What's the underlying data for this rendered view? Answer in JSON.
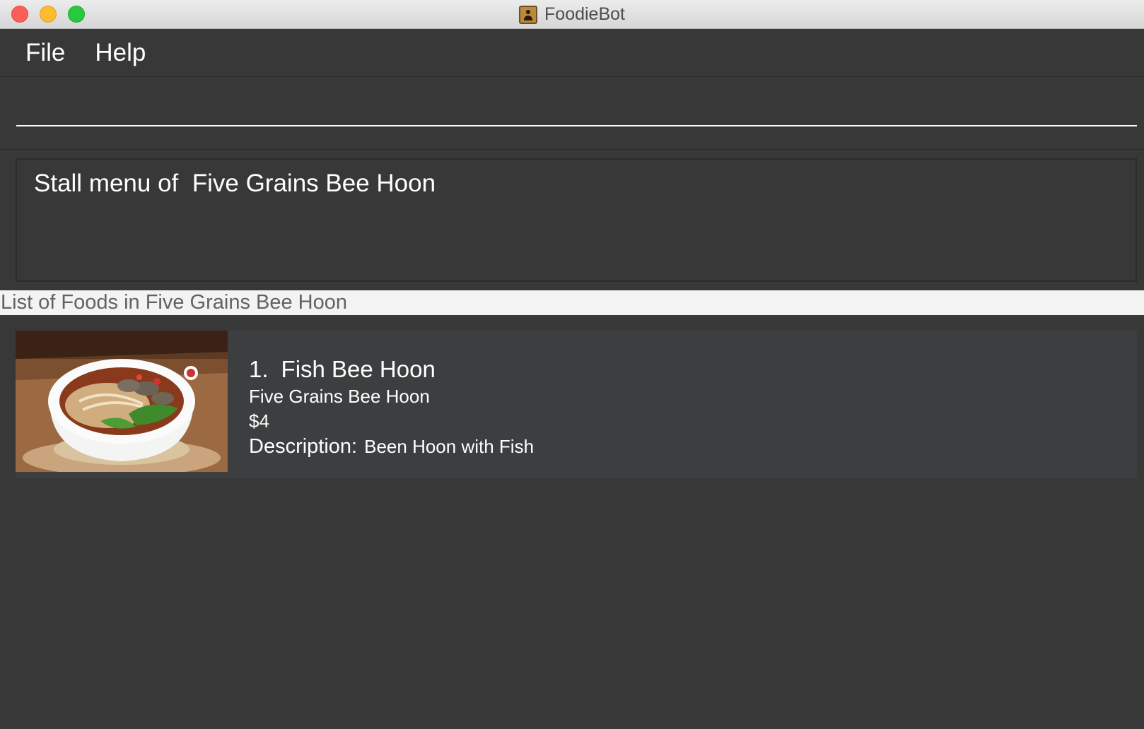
{
  "window": {
    "title": "FoodieBot"
  },
  "menu": {
    "items": [
      {
        "label": "File"
      },
      {
        "label": "Help"
      }
    ]
  },
  "command": {
    "value": ""
  },
  "result": {
    "text": "Stall menu of  Five Grains Bee Hoon"
  },
  "list": {
    "header": "List of Foods in Five Grains Bee Hoon",
    "foods": [
      {
        "index": "1.",
        "name": "Fish Bee Hoon",
        "stall": "Five Grains Bee Hoon",
        "price": "$4",
        "description_label": "Description:",
        "description": "Been Hoon with Fish"
      }
    ]
  },
  "colors": {
    "background": "#383838",
    "card": "#3c3e3f",
    "header_bar": "#f3f3f3",
    "close": "#fc5f57",
    "minimize": "#fdbc2e",
    "zoom": "#28c840"
  }
}
